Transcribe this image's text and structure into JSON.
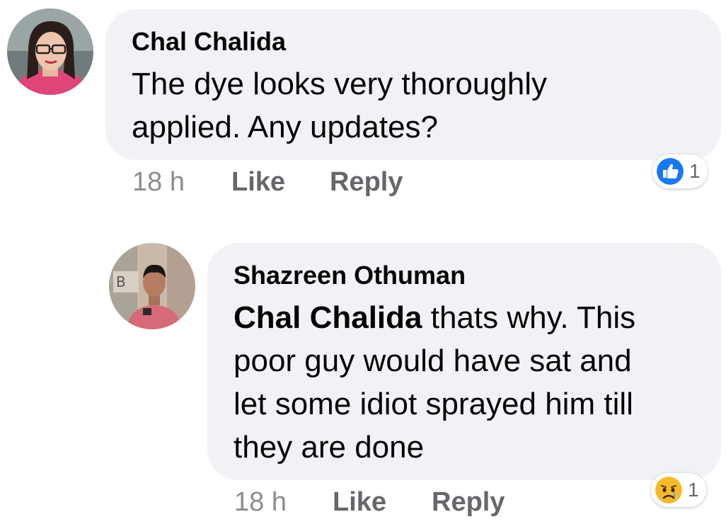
{
  "comments": [
    {
      "author": "Chal Chalida",
      "text_line1": "The dye looks very thoroughly",
      "text_line2": "applied. Any updates?",
      "time": "18 h",
      "like_label": "Like",
      "reply_label": "Reply",
      "reaction_icon": "thumbs-up-icon",
      "reaction_count": "1"
    },
    {
      "author": "Shazreen Othuman",
      "mention": "Chal Chalida",
      "text_line1_rest": " thats why. This",
      "text_line2": "poor guy would have sat and",
      "text_line3": "let some idiot sprayed him till",
      "text_line4": "they are done",
      "time": "18 h",
      "like_label": "Like",
      "reply_label": "Reply",
      "reaction_icon": "sad-face-icon",
      "reaction_count": "1"
    }
  ],
  "colors": {
    "bubble": "#f0f2f5",
    "meta_text": "#65676b",
    "like_blue": "#1877f2",
    "sad_yellow": "#f7b928"
  }
}
